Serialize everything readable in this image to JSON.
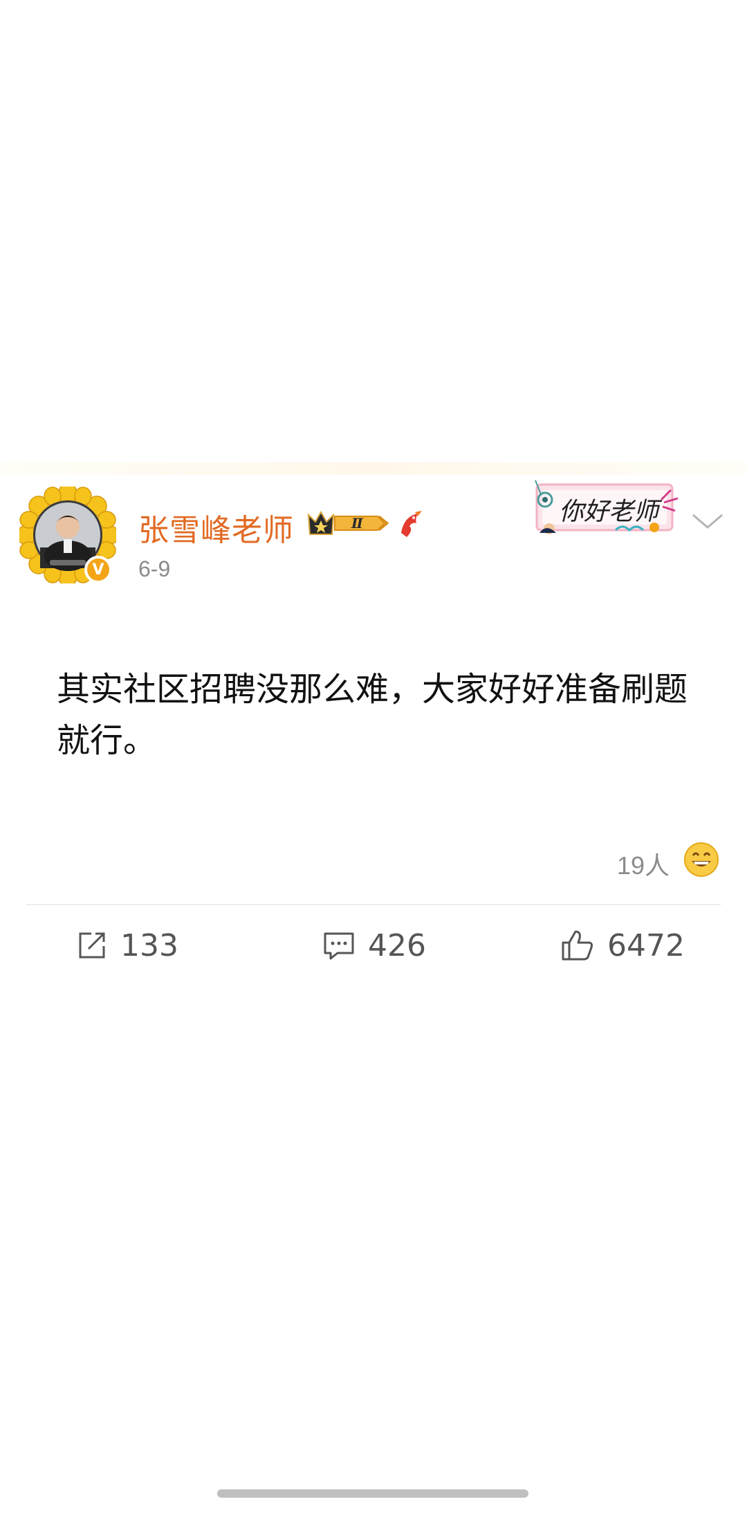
{
  "post": {
    "author": {
      "name": "张雪峰老师",
      "verified_mark": "V",
      "avatar_icon": "sunflower-avatar-frame",
      "vip_level": "Ⅱ",
      "vip_badge_icon": "crown-vip-badge",
      "extra_badge_icon": "red-fish-icon"
    },
    "date": "6-9",
    "sticker_text": "你好老师",
    "content": "其实社区招聘没那么难，大家好好准备刷题就行。",
    "reactions": {
      "count_label": "19人",
      "icon": "grinning-emoji-icon"
    },
    "actions": {
      "repost": {
        "icon": "repost-icon",
        "count": "133"
      },
      "comment": {
        "icon": "comment-icon",
        "count": "426"
      },
      "like": {
        "icon": "thumbs-up-icon",
        "count": "6472"
      }
    },
    "more_icon": "chevron-down-icon"
  },
  "colors": {
    "username": "#e26a23",
    "secondary_text": "#8c8c8c",
    "divider": "#ececec",
    "verified_badge": "#f4a417"
  }
}
